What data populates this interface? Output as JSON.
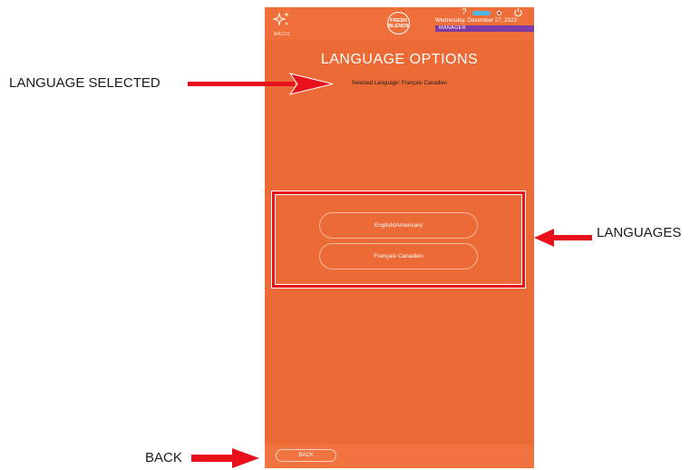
{
  "header": {
    "machine_id": "MAC01",
    "logo_text": "FRESH BLENDS",
    "date": "Wednesday, December 27, 2023",
    "role": "MANAGER",
    "help_label": "?"
  },
  "main": {
    "title": "LANGUAGE OPTIONS",
    "selected_language_text": "Selected Language: Français Canadien",
    "languages": [
      {
        "label": "English(American)"
      },
      {
        "label": "Français Canadien"
      }
    ]
  },
  "footer": {
    "back_label": "BACK"
  },
  "annotations": {
    "language_selected": "LANGUAGE SELECTED",
    "languages": "LANGUAGES",
    "back": "BACK"
  },
  "colors": {
    "screen_background": "#ec6a36",
    "role_bar": "#7e3aa2",
    "status_pill": "#4fb7e3",
    "annotation_red": "#e8101a"
  }
}
